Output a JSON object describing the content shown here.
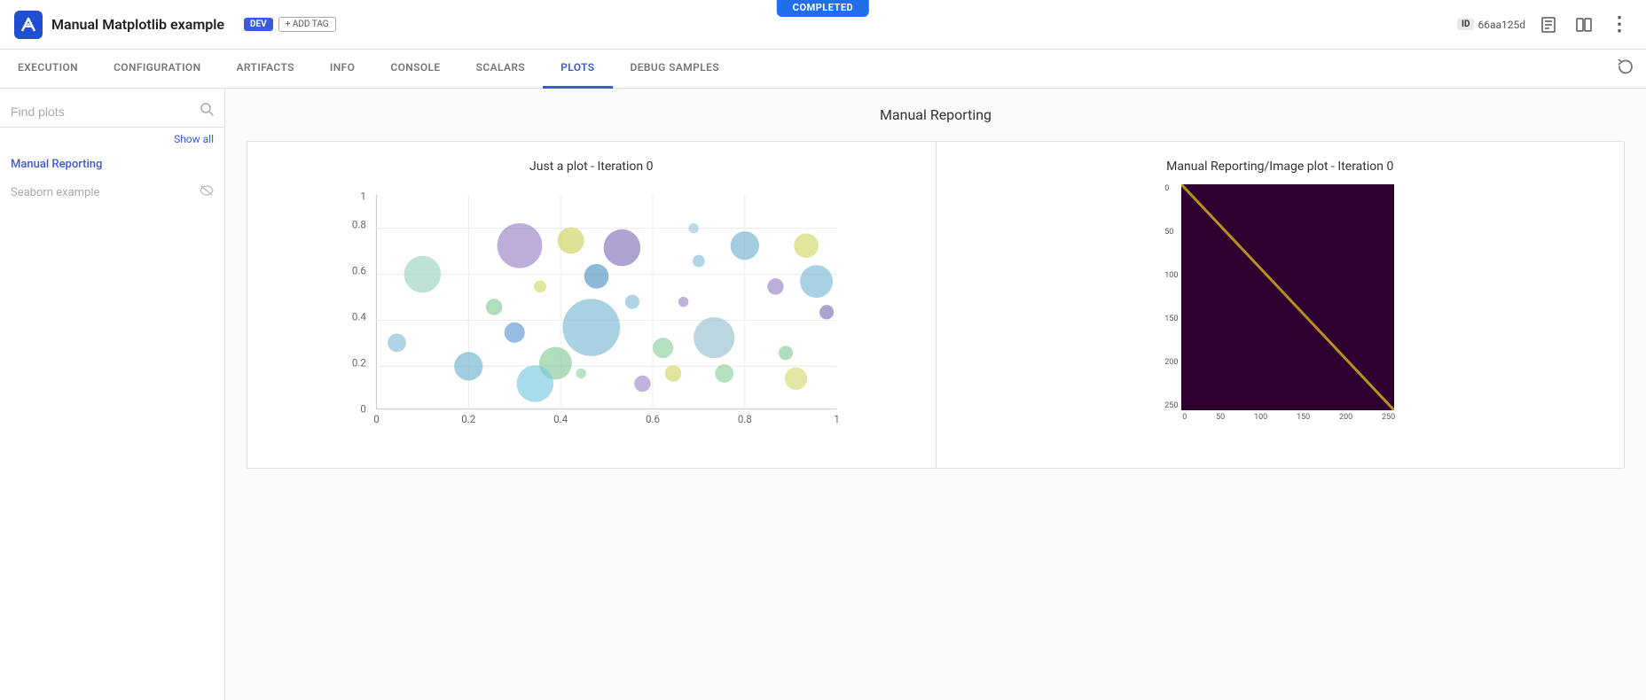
{
  "app": {
    "title": "Manual Matplotlib example",
    "tag_dev": "DEV",
    "tag_add": "+ ADD TAG",
    "completed": "COMPLETED",
    "id_label": "ID",
    "id_value": "66aa125d"
  },
  "nav": {
    "tabs": [
      {
        "label": "EXECUTION",
        "active": false
      },
      {
        "label": "CONFIGURATION",
        "active": false
      },
      {
        "label": "ARTIFACTS",
        "active": false
      },
      {
        "label": "INFO",
        "active": false
      },
      {
        "label": "CONSOLE",
        "active": false
      },
      {
        "label": "SCALARS",
        "active": false
      },
      {
        "label": "PLOTS",
        "active": true
      },
      {
        "label": "DEBUG SAMPLES",
        "active": false
      }
    ]
  },
  "sidebar": {
    "search_placeholder": "Find plots",
    "show_all": "Show all",
    "items": [
      {
        "label": "Manual Reporting",
        "active": true
      },
      {
        "label": "Seaborn example",
        "active": false,
        "hidden": true
      }
    ]
  },
  "content": {
    "section_title": "Manual Reporting",
    "plot1": {
      "title": "Just a plot - Iteration 0"
    },
    "plot2": {
      "title": "Manual Reporting/Image plot - Iteration 0"
    }
  },
  "matrix_axis": {
    "left": [
      "0",
      "50",
      "100",
      "150",
      "200",
      "250"
    ],
    "bottom": [
      "0",
      "50",
      "100",
      "150",
      "200",
      "250"
    ]
  },
  "icons": {
    "logo": "◤",
    "search": "🔍",
    "id": "ID",
    "doc": "≡",
    "split": "⊞",
    "menu": "⋮",
    "refresh": "⟳",
    "hide": "👁"
  }
}
